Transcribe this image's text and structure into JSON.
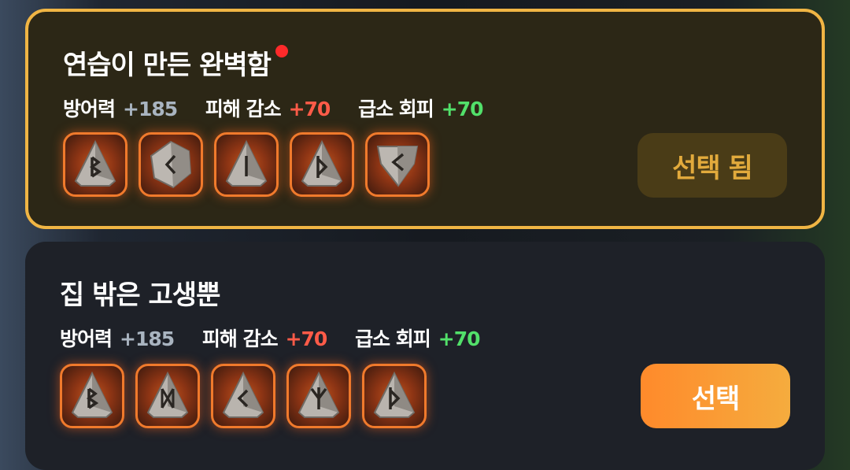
{
  "cards": [
    {
      "title": "연습이 만든 완벽함",
      "has_notification_dot": true,
      "selected": true,
      "stats": [
        {
          "label": "방어력",
          "value": "+185",
          "color": "#a9b4c0"
        },
        {
          "label": "피해 감소",
          "value": "+70",
          "color": "#ff5b48"
        },
        {
          "label": "급소 회피",
          "value": "+70",
          "color": "#52e06a"
        }
      ],
      "runes": [
        "rune-berkano-icon",
        "rune-kaunan-hex-icon",
        "rune-isa-icon",
        "rune-thurisaz-icon",
        "rune-kaunan-shield-icon"
      ],
      "button_label": "선택 됨"
    },
    {
      "title": "집 밖은 고생뿐",
      "has_notification_dot": false,
      "selected": false,
      "stats": [
        {
          "label": "방어력",
          "value": "+185",
          "color": "#a9b4c0"
        },
        {
          "label": "피해 감소",
          "value": "+70",
          "color": "#ff5b48"
        },
        {
          "label": "급소 회피",
          "value": "+70",
          "color": "#52e06a"
        }
      ],
      "runes": [
        "rune-berkano-icon",
        "rune-dagaz-icon",
        "rune-kaunan-icon",
        "rune-algiz-icon",
        "rune-thurisaz-icon"
      ],
      "button_label": "선택"
    }
  ],
  "colors": {
    "selected_border": "#f0b544",
    "accent_orange": "#ff8a2b",
    "notification_dot": "#ff2a2a"
  }
}
